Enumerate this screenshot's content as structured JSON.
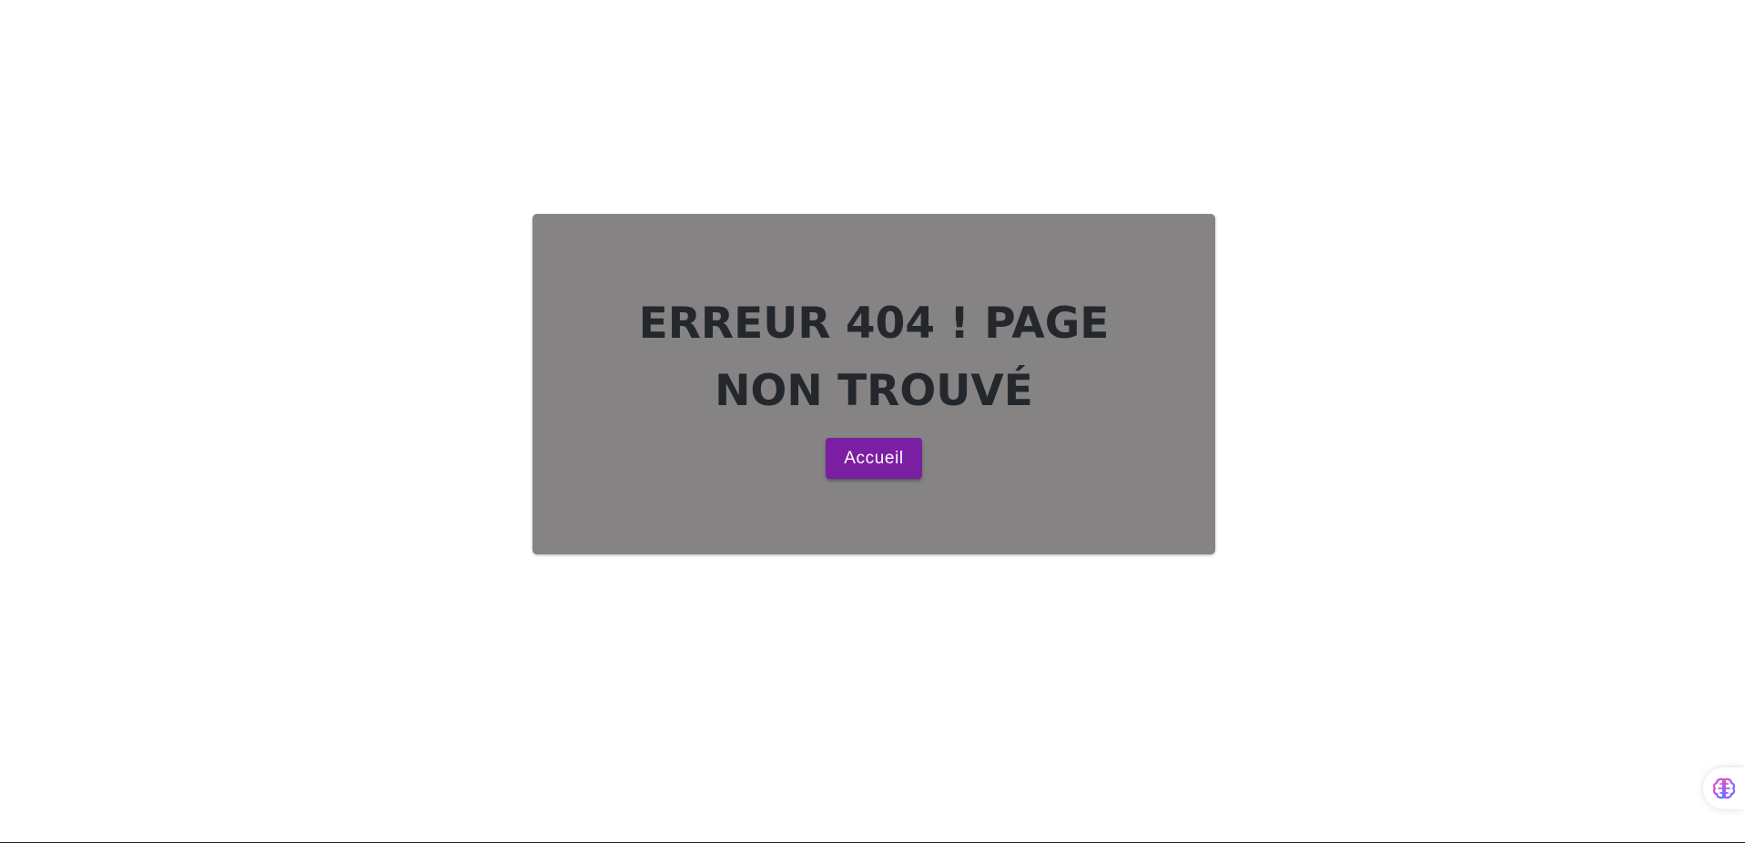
{
  "error_card": {
    "title": "ERREUR 404 ! PAGE NON TROUVÉ",
    "home_button_label": "Accueil"
  },
  "assistant_widget": {
    "icon": "brain-icon"
  },
  "colors": {
    "card_background": "#858384",
    "title_text": "#24282c",
    "button_background": "#7b1fa2",
    "button_text": "#ffffff"
  }
}
